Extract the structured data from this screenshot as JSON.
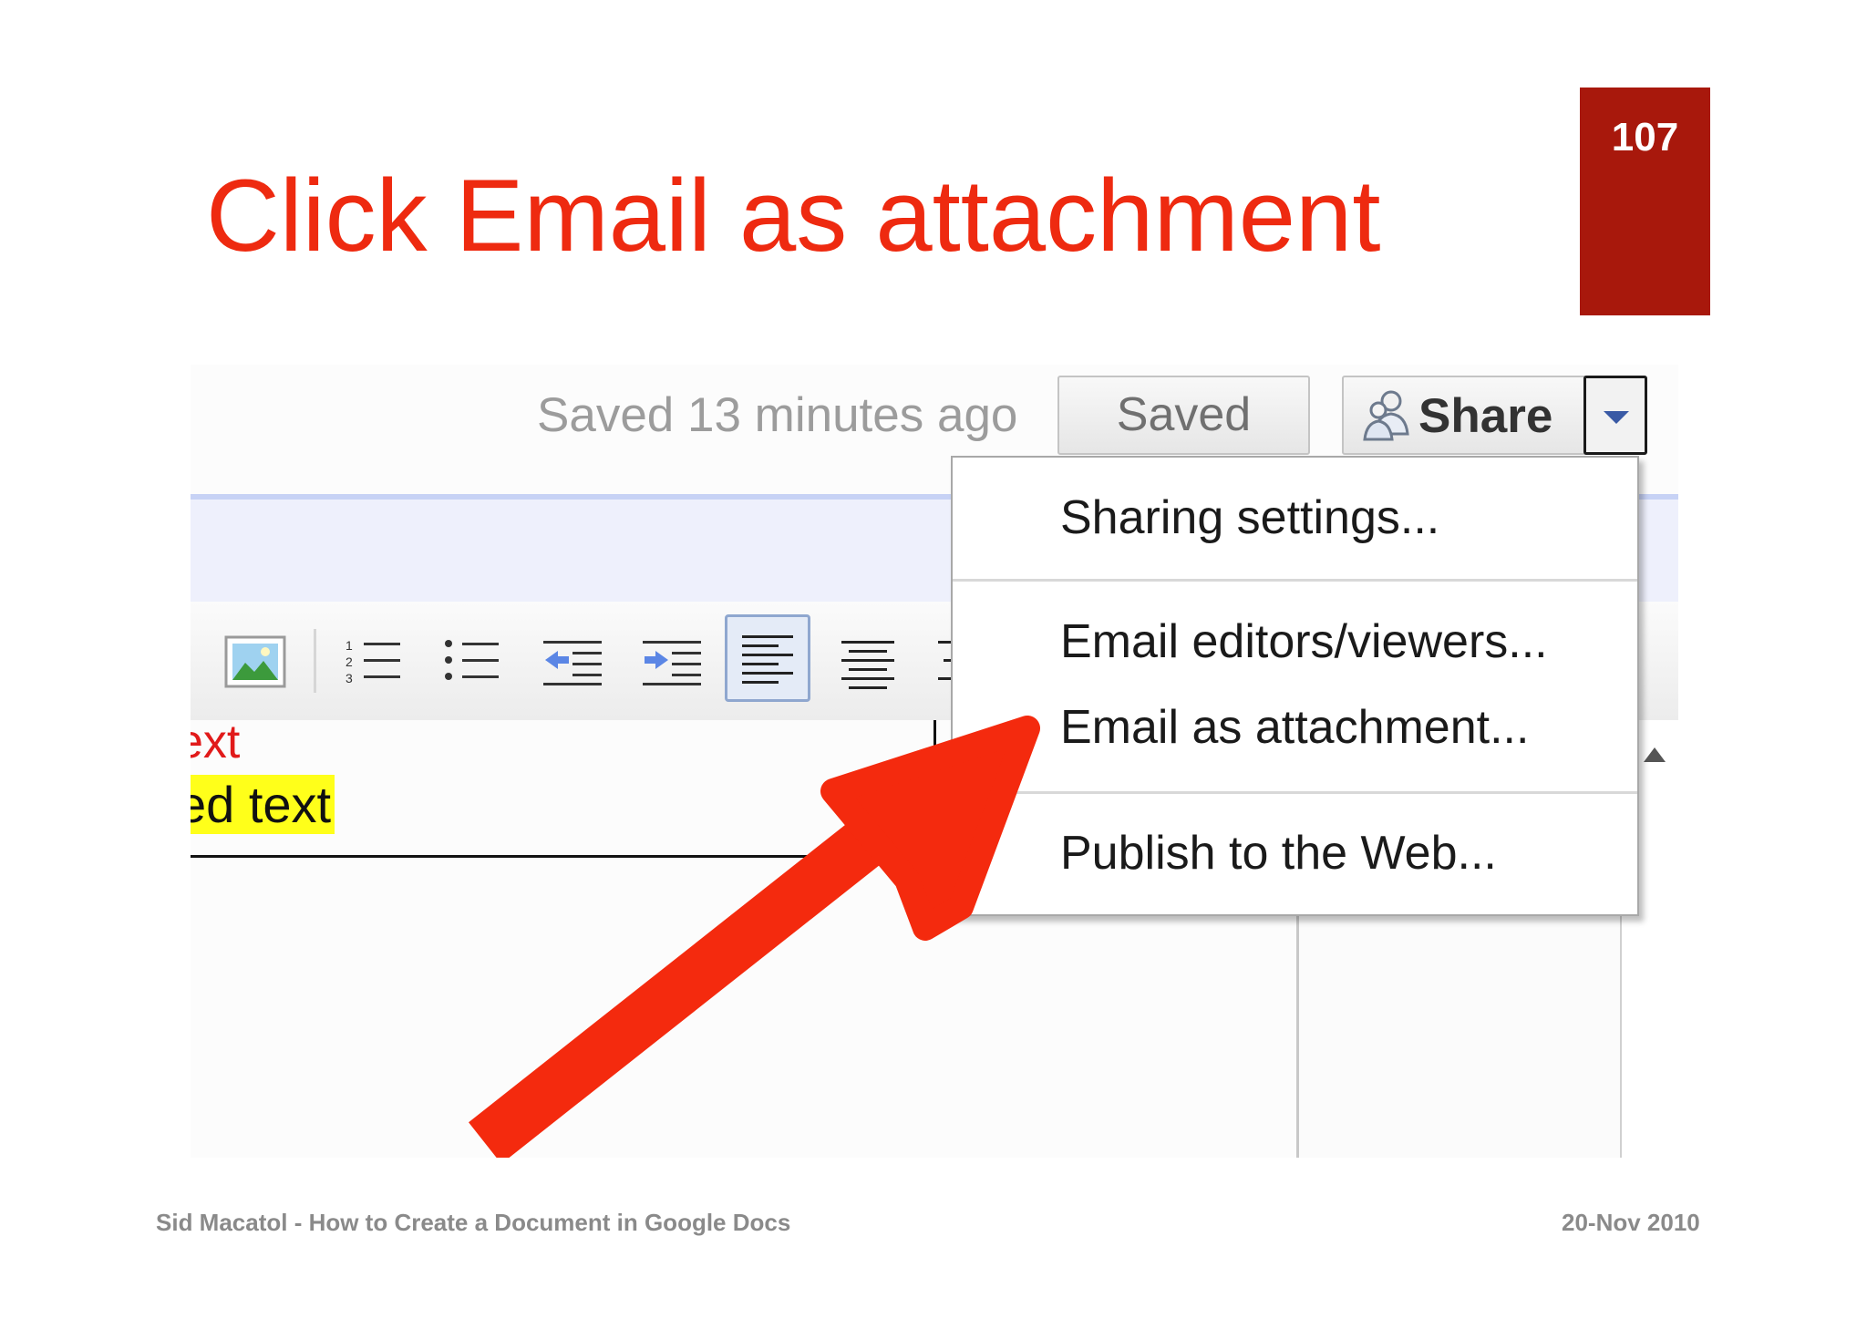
{
  "slide": {
    "title": "Click Email as attachment",
    "page_number": "107"
  },
  "header_bar": {
    "status_text": "Saved 13 minutes ago",
    "saved_button_label": "Saved",
    "share_button_label": "Share"
  },
  "share_menu": {
    "items": [
      {
        "label": "Sharing settings..."
      },
      {
        "label": "Email editors/viewers..."
      },
      {
        "label": "Email as attachment..."
      },
      {
        "label": "Publish to the Web..."
      }
    ]
  },
  "document": {
    "red_text_fragment": "ext",
    "highlighted_text_fragment": "ed text"
  },
  "toolbar": {
    "icons": [
      "insert-image-icon",
      "numbered-list-icon",
      "bulleted-list-icon",
      "decrease-indent-icon",
      "increase-indent-icon",
      "align-left-icon",
      "align-center-icon",
      "align-right-icon"
    ],
    "active": "align-left-icon"
  },
  "footer": {
    "left": "Sid Macatol - How to Create a Document in Google Docs",
    "right": "20-Nov 2010"
  },
  "colors": {
    "title": "#ee2a10",
    "page_number_box": "#a8180c",
    "arrow": "#f42a0e",
    "highlight": "#ffff1a"
  }
}
